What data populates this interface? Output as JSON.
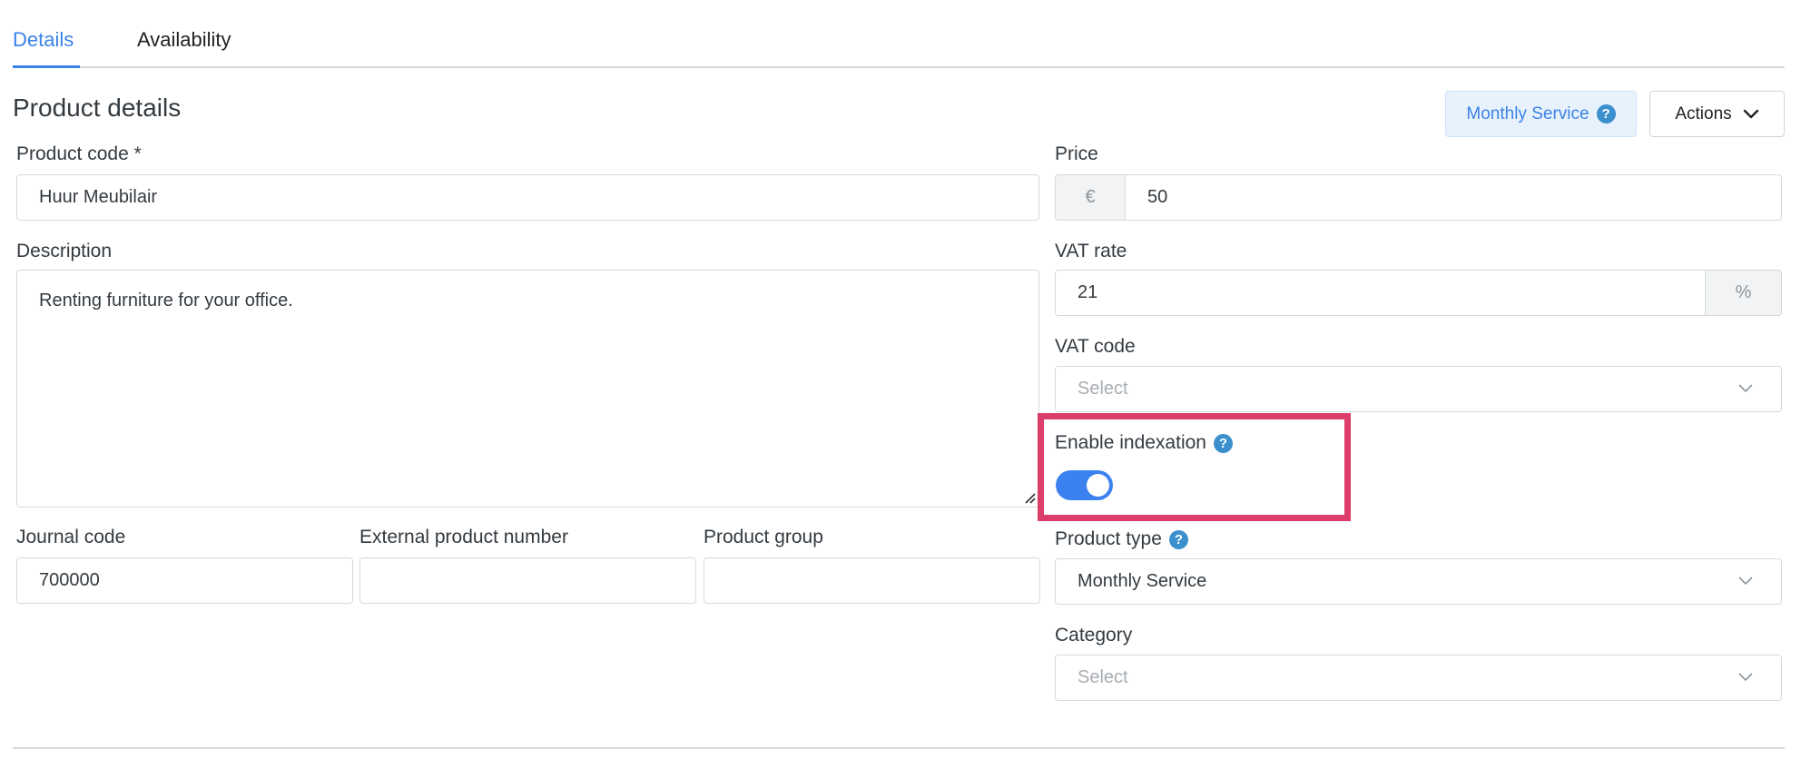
{
  "tabs": [
    {
      "label": "Details",
      "active": true
    },
    {
      "label": "Availability",
      "active": false
    }
  ],
  "section_title": "Product details",
  "header": {
    "badge_label": "Monthly Service",
    "badge_icon": "question-circle-icon",
    "actions_label": "Actions"
  },
  "fields": {
    "product_code": {
      "label": "Product code *",
      "value": "Huur Meubilair"
    },
    "description": {
      "label": "Description",
      "value": "Renting furniture for your office."
    },
    "journal_code": {
      "label": "Journal code",
      "value": "700000"
    },
    "external_product_number": {
      "label": "External product number",
      "value": ""
    },
    "product_group": {
      "label": "Product group",
      "value": ""
    },
    "price": {
      "label": "Price",
      "prefix": "€",
      "value": "50"
    },
    "vat_rate": {
      "label": "VAT rate",
      "value": "21",
      "suffix": "%"
    },
    "vat_code": {
      "label": "VAT code",
      "placeholder": "Select"
    },
    "enable_indexation": {
      "label": "Enable indexation",
      "on": true
    },
    "product_type": {
      "label": "Product type",
      "value": "Monthly Service"
    },
    "category": {
      "label": "Category",
      "placeholder": "Select"
    }
  },
  "colors": {
    "accent": "#3b82e6",
    "highlight": "#dc3d6a",
    "help_icon": "#3a8fcc"
  }
}
